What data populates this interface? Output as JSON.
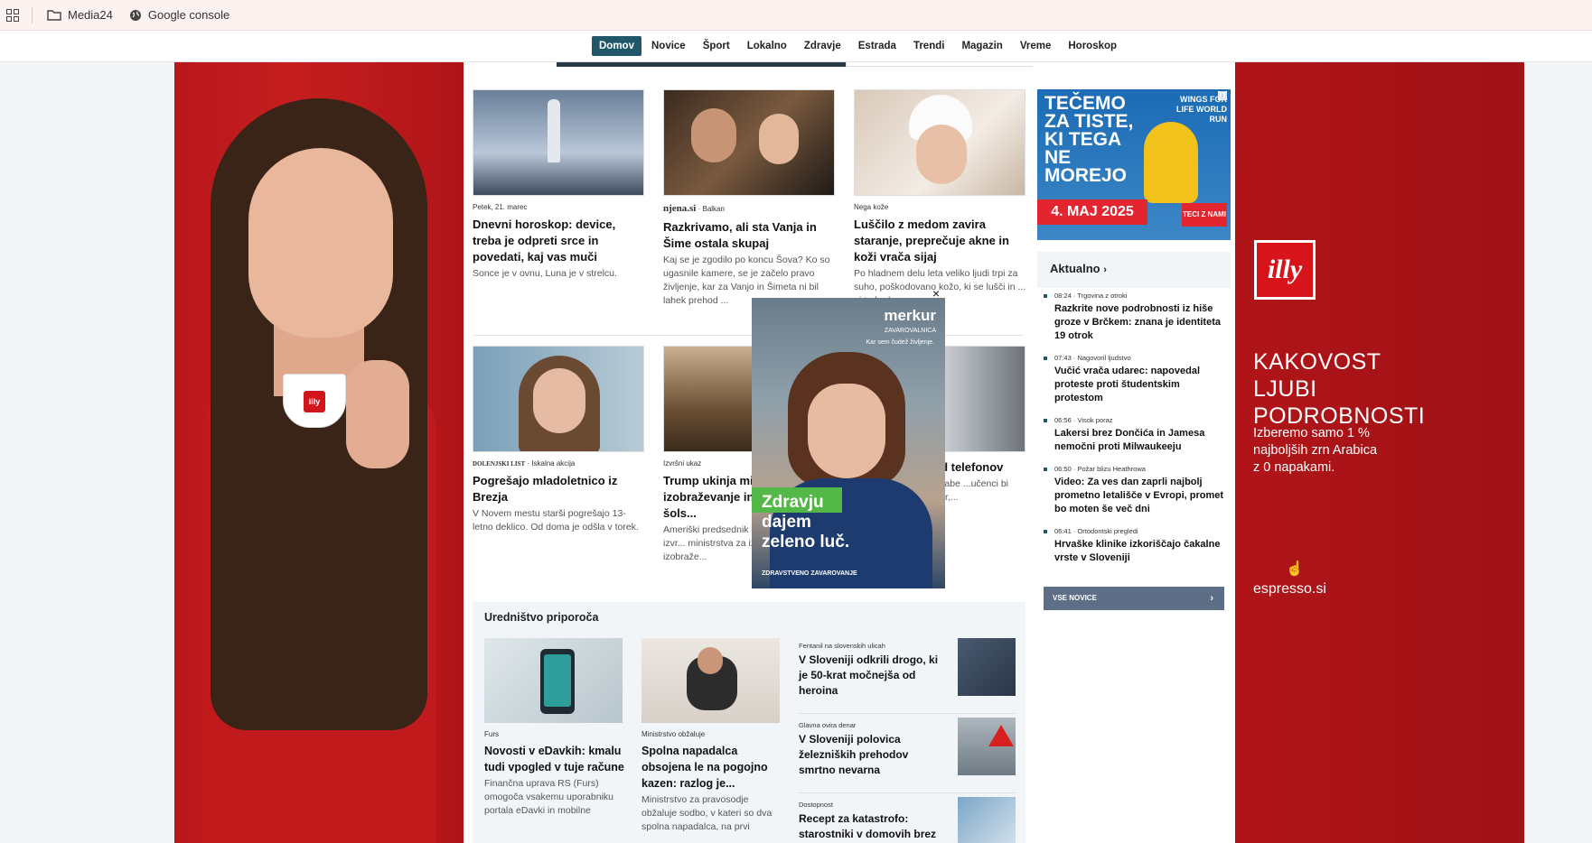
{
  "bookmarks": {
    "items": [
      {
        "label": "Media24",
        "icon": "folder-icon"
      },
      {
        "label": "Google console",
        "icon": "globe-icon"
      }
    ]
  },
  "nav": {
    "items": [
      "Domov",
      "Novice",
      "Šport",
      "Lokalno",
      "Zdravje",
      "Estrada",
      "Trendi",
      "Magazin",
      "Vreme",
      "Horoskop"
    ],
    "active": "Domov"
  },
  "left_skin": {
    "cup_logo": "illy",
    "colors": {
      "primary": "#c01a1d"
    }
  },
  "right_skin": {
    "logo": "illy",
    "headline": [
      "KAKOVOST",
      "LJUBI",
      "PODROBNOSTI"
    ],
    "sub": [
      "Izberemo samo 1 %",
      "najboljših zrn Arabica",
      "z 0 napakami."
    ],
    "brand": "espresso.si",
    "brand_icon": "touch-icon"
  },
  "cards_row1": [
    {
      "meta": "Petek, 21. marec",
      "title": "Dnevni horoskop: device, treba je odpreti srce in povedati, kaj vas muči",
      "desc": "Sonce je v ovnu, Luna je v strelcu."
    },
    {
      "source": "njena.si",
      "meta": "Balkan",
      "title": "Razkrivamo, ali sta Vanja in Šime ostala skupaj",
      "desc": "Kaj se je zgodilo po koncu Šova? Ko so ugasnile kamere, se je začelo pravo življenje, kar za Vanjo in Šimeta ni bil lahek prehod ..."
    },
    {
      "meta": "Nega kože",
      "title": "Luščilo z medom zavira staranje, preprečuje akne in koži vrača sijaj",
      "desc": "Po hladnem delu leta veliko ljudi trpi za suho, poškodovano kožo, ki se lušči in ... ni treba kar"
    }
  ],
  "cards_row2": [
    {
      "source": "DOLENJSKI LIST",
      "meta": "Iskalna akcija",
      "title": "Pogrešajo mladoletnico iz Brezja",
      "desc": "V Novem mestu starši pogrešajo 13-letno deklico. Od doma je odšla v torek."
    },
    {
      "meta": "Izvršni ukaz",
      "title": "Trump ukinja mi... izobraževanje in \"neodvisno\" šols...",
      "desc": "Ameriški predsednik ... četrtek podpisal izvr... ministrstva za izobra... dejal, da bo izobraže..."
    },
    {
      "meta": "",
      "title": "...orali pred ... od telefonov",
      "desc": "...kona o osnovni ...orabe ...učenci bi morali ...seben prostor,..."
    }
  ],
  "recommended": {
    "title": "Uredništvo priporoča",
    "cards": [
      {
        "meta": "Furs",
        "title": "Novosti v eDavkih: kmalu tudi vpogled v tuje račune",
        "desc": "Finančna uprava RS (Furs) omogoča vsakemu uporabniku portala eDavki in mobilne"
      },
      {
        "meta": "Ministrstvo obžaluje",
        "title": "Spolna napadalca obsojena le na pogojno kazen: razlog je...",
        "desc": "Ministrstvo za pravosodje obžaluje sodbo, v kateri so dva spolna napadalca, na prvi"
      }
    ],
    "list": [
      {
        "meta": "Fentanil na slovenskih ulicah",
        "title": "V Sloveniji odkrili drogo, ki je 50-krat močnejša od heroina"
      },
      {
        "meta": "Glavna ovira denar",
        "title": "V Sloveniji polovica železniških prehodov smrtno nevarna"
      },
      {
        "meta": "Dostopnost",
        "title": "Recept za katastrofo: starostniki v domovih brez"
      }
    ]
  },
  "sidebar": {
    "ad": {
      "text": [
        "TEČEMO",
        "ZA TISTE,",
        "KI TEGA",
        "NE",
        "MOREJO"
      ],
      "logo": "WINGS FOR LIFE WORLD RUN",
      "date": "4. MAJ 2025",
      "cta": "TECI Z NAMI"
    },
    "aktualno_label": "Aktualno",
    "news": [
      {
        "time": "08:24",
        "tag": "Trgovina z otroki",
        "title": "Razkrite nove podrobnosti iz hiše groze v Brčkem: znana je identiteta 19 otrok"
      },
      {
        "time": "07:43",
        "tag": "Nagovoril ljudstvo",
        "title": "Vučić vrača udarec: napovedal proteste proti študentskim protestom"
      },
      {
        "time": "06:56",
        "tag": "Visok poraz",
        "title": "Lakersi brez Dončića in Jamesa nemočni proti Milwaukeeju"
      },
      {
        "time": "06:50",
        "tag": "Požar blizu Heathrowa",
        "title": "Video: Za ves dan zaprli najbolj prometno letališče v Evropi, promet bo moten še več dni"
      },
      {
        "time": "06:41",
        "tag": "Ortodontski pregledi",
        "title": "Hrvaške klinike izkoriščajo čakalne vrste v Sloveniji"
      }
    ],
    "all_news_label": "VSE NOVICE"
  },
  "popup_ad": {
    "logo": "merkur",
    "sub": "ZAVAROVALNICA",
    "tagline": "Kar sem čudež življenje.",
    "text": [
      "Zdravju",
      "dajem",
      "zeleno luč."
    ],
    "foot": "ZDRAVSTVENO ZAVAROVANJE",
    "close": "×"
  }
}
